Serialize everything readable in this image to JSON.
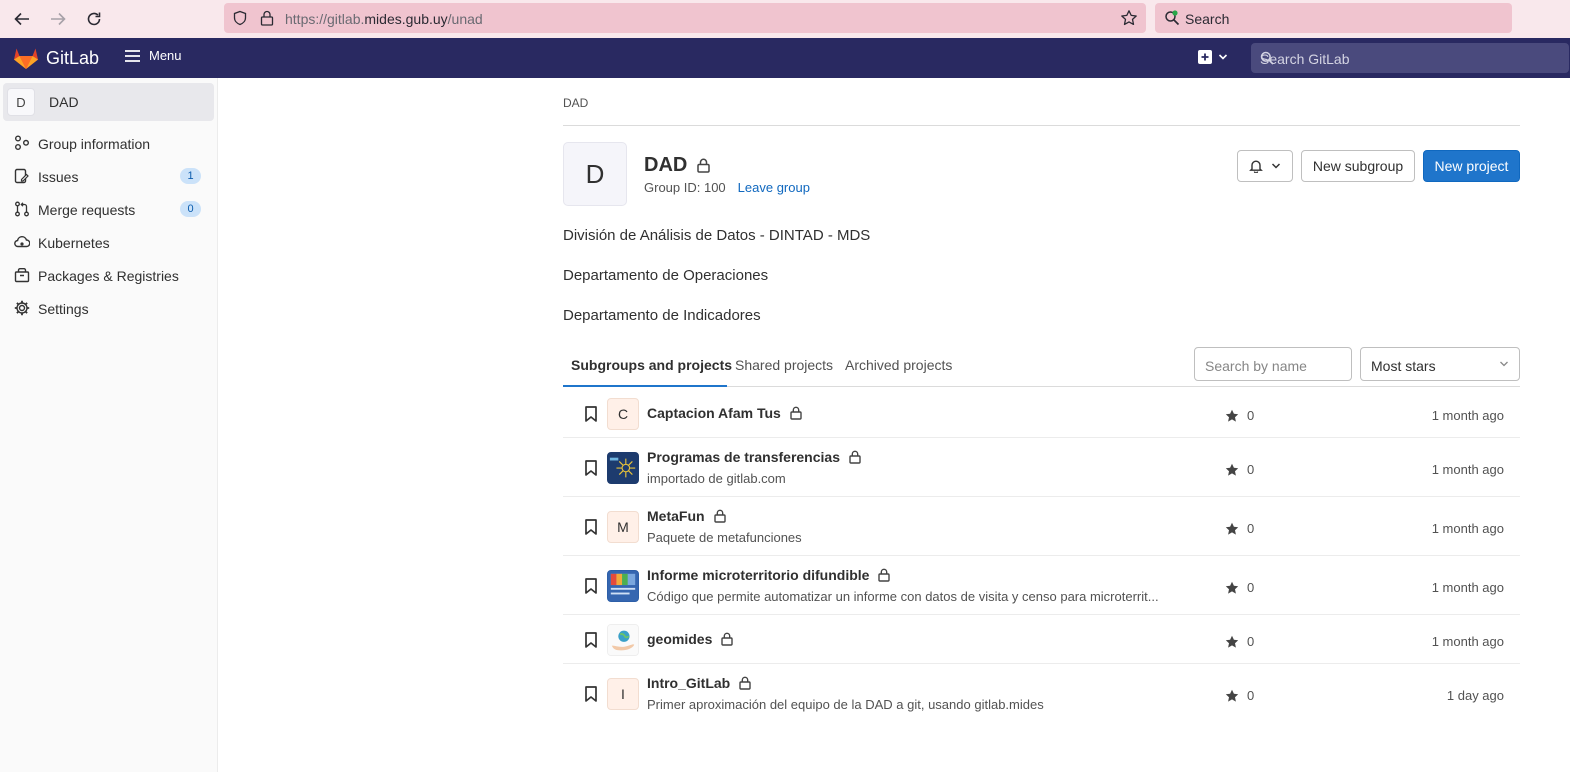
{
  "browser": {
    "url_prefix": "https://gitlab.",
    "url_domain": "mides.gub.uy",
    "url_path": "/unad",
    "search_placeholder": "Search"
  },
  "header": {
    "brand": "GitLab",
    "menu_label": "Menu",
    "search_placeholder": "Search GitLab",
    "colors": {
      "bg": "#292961",
      "search_bg": "#4a4a7d"
    }
  },
  "sidebar": {
    "context": {
      "avatar_letter": "D",
      "name": "DAD"
    },
    "items": [
      {
        "label": "Group information",
        "icon": "group-icon",
        "badge": ""
      },
      {
        "label": "Issues",
        "icon": "issues-icon",
        "badge": "1"
      },
      {
        "label": "Merge requests",
        "icon": "merge-request-icon",
        "badge": "0"
      },
      {
        "label": "Kubernetes",
        "icon": "kubernetes-icon",
        "badge": ""
      },
      {
        "label": "Packages & Registries",
        "icon": "package-icon",
        "badge": ""
      },
      {
        "label": "Settings",
        "icon": "settings-icon",
        "badge": ""
      }
    ]
  },
  "group": {
    "breadcrumb": "DAD",
    "avatar_letter": "D",
    "name": "DAD",
    "id_label": "Group ID: 100",
    "leave_label": "Leave group",
    "new_subgroup_label": "New subgroup",
    "new_project_label": "New project",
    "description_lines": [
      "División de Análisis de Datos - DINTAD - MDS",
      "Departamento de Operaciones",
      "Departamento de Indicadores"
    ]
  },
  "tabs": [
    {
      "label": "Subgroups and projects",
      "active": true
    },
    {
      "label": "Shared projects",
      "active": false
    },
    {
      "label": "Archived projects",
      "active": false
    }
  ],
  "filter": {
    "search_placeholder": "Search by name",
    "sort_label": "Most stars"
  },
  "projects": [
    {
      "avatar": "C",
      "name": "Captacion Afam Tus",
      "description": "",
      "stars": "0",
      "updated": "1 month ago",
      "avatar_kind": "letter"
    },
    {
      "avatar": "",
      "name": "Programas de transferencias",
      "description": "importado de gitlab.com",
      "stars": "0",
      "updated": "1 month ago",
      "avatar_kind": "image-blue-pattern"
    },
    {
      "avatar": "M",
      "name": "MetaFun",
      "description": "Paquete de metafunciones",
      "stars": "0",
      "updated": "1 month ago",
      "avatar_kind": "letter"
    },
    {
      "avatar": "",
      "name": "Informe microterritorio difundible",
      "description": "Código que permite automatizar un informe con datos de visita y censo para microterrit...",
      "stars": "0",
      "updated": "1 month ago",
      "avatar_kind": "image-report"
    },
    {
      "avatar": "",
      "name": "geomides",
      "description": "",
      "stars": "0",
      "updated": "1 month ago",
      "avatar_kind": "image-globe-hand"
    },
    {
      "avatar": "I",
      "name": "Intro_GitLab",
      "description": "Primer aproximación del equipo de la DAD a git, usando gitlab.mides",
      "stars": "0",
      "updated": "1 day ago",
      "avatar_kind": "letter"
    }
  ]
}
